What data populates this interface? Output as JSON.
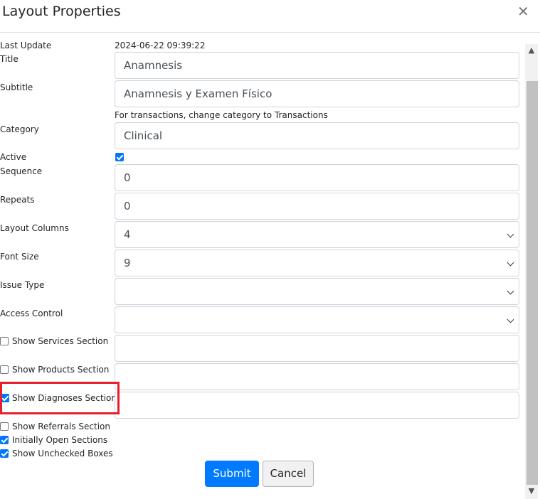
{
  "modal": {
    "title": "Layout Properties",
    "close_icon": "close-icon"
  },
  "form": {
    "last_update": {
      "label": "Last Update",
      "value": "2024-06-22 09:39:22"
    },
    "title": {
      "label": "Title",
      "value": "Anamnesis"
    },
    "subtitle": {
      "label": "Subtitle",
      "value": "Anamnesis y Examen Físico"
    },
    "category_help": "For transactions, change category to Transactions",
    "category": {
      "label": "Category",
      "value": "Clinical"
    },
    "active": {
      "label": "Active",
      "checked": true
    },
    "sequence": {
      "label": "Sequence",
      "value": "0"
    },
    "repeats": {
      "label": "Repeats",
      "value": "0"
    },
    "layout_columns": {
      "label": "Layout Columns",
      "value": "4"
    },
    "font_size": {
      "label": "Font Size",
      "value": "9"
    },
    "issue_type": {
      "label": "Issue Type",
      "value": ""
    },
    "access_control": {
      "label": "Access Control",
      "value": ""
    },
    "show_services": {
      "label": "Show Services Section",
      "checked": false,
      "value": ""
    },
    "show_products": {
      "label": "Show Products Section",
      "checked": false,
      "value": ""
    },
    "show_diagnoses": {
      "label": "Show Diagnoses Section",
      "checked": true,
      "value": ""
    },
    "show_referrals": {
      "label": "Show Referrals Section",
      "checked": false
    },
    "initially_open": {
      "label": "Initially Open Sections",
      "checked": true
    },
    "show_unchecked": {
      "label": "Show Unchecked Boxes",
      "checked": true
    }
  },
  "buttons": {
    "submit": "Submit",
    "cancel": "Cancel"
  },
  "colors": {
    "primary": "#007bff",
    "highlight": "#e5202a",
    "checkbox": "#0075ff"
  }
}
